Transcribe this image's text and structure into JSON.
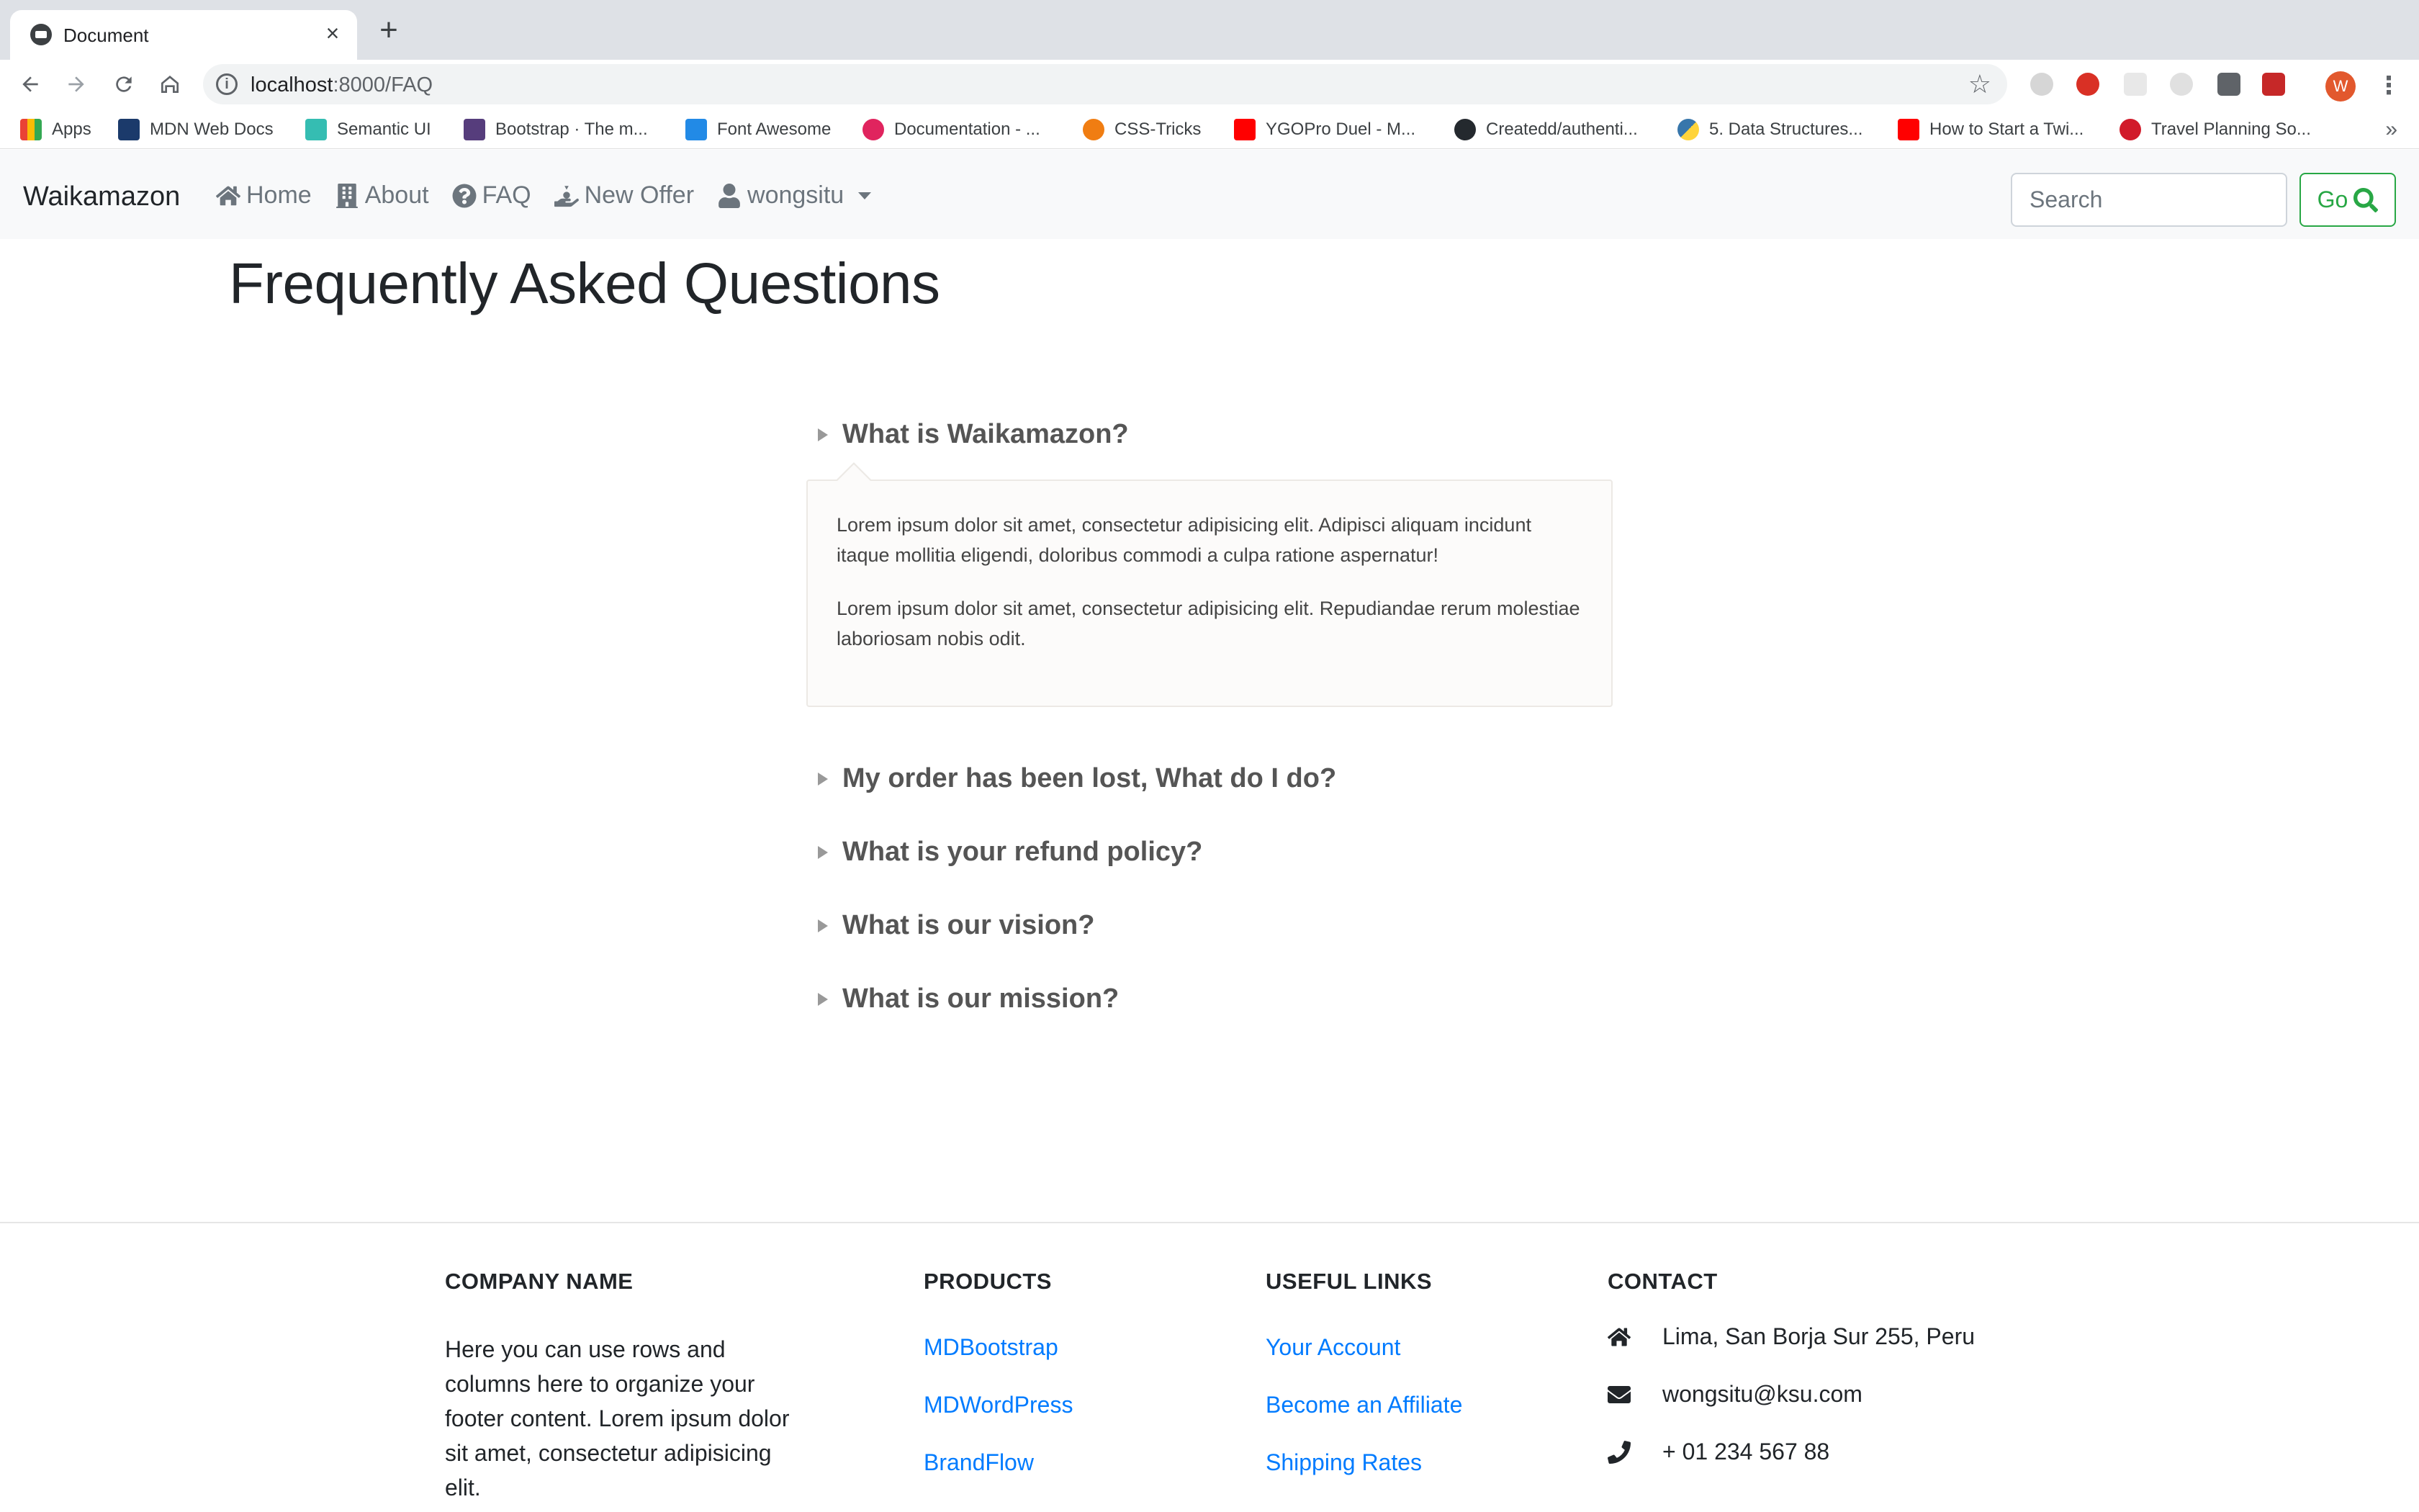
{
  "browser": {
    "tab_title": "Document",
    "url_host": "localhost",
    "url_rest": ":8000/FAQ",
    "profile_initial": "W",
    "bookmarks": [
      {
        "label": "Apps",
        "icon": "apps-grid-icon",
        "color": "#4285f4"
      },
      {
        "label": "MDN Web Docs",
        "icon": "mdn-icon",
        "color": "#1b3a6b"
      },
      {
        "label": "Semantic UI",
        "icon": "semantic-ui-icon",
        "color": "#35bdb2"
      },
      {
        "label": "Bootstrap · The m...",
        "icon": "bootstrap-icon",
        "color": "#563d7c"
      },
      {
        "label": "Font Awesome",
        "icon": "flag-icon",
        "color": "#228ae6"
      },
      {
        "label": "Documentation - ...",
        "icon": "documentation-icon",
        "color": "#e0245e"
      },
      {
        "label": "CSS-Tricks",
        "icon": "css-tricks-icon",
        "color": "#f07d12"
      },
      {
        "label": "YGOPro Duel - M...",
        "icon": "youtube-icon",
        "color": "#ff0000"
      },
      {
        "label": "Createdd/authenti...",
        "icon": "github-icon",
        "color": "#24292e"
      },
      {
        "label": "5. Data Structures...",
        "icon": "python-icon",
        "color": "#3776ab"
      },
      {
        "label": "How to Start a Twi...",
        "icon": "youtube-icon",
        "color": "#ff0000"
      },
      {
        "label": "Travel Planning So...",
        "icon": "travel-icon",
        "color": "#d11a2a"
      }
    ],
    "bookmarks_more": "»"
  },
  "navbar": {
    "brand": "Waikamazon",
    "links": [
      {
        "label": "Home",
        "icon": "home-icon"
      },
      {
        "label": "About",
        "icon": "building-icon"
      },
      {
        "label": "FAQ",
        "icon": "question-circle-icon"
      },
      {
        "label": "New Offer",
        "icon": "hand-holding-icon"
      },
      {
        "label": "wongsitu",
        "icon": "user-icon"
      }
    ],
    "search_placeholder": "Search",
    "go_label": "Go"
  },
  "faq": {
    "title": "Frequently Asked Questions",
    "questions": [
      {
        "q": "What is Waikamazon?",
        "expanded": true
      },
      {
        "q": "My order has been lost, What do I do?",
        "expanded": false
      },
      {
        "q": "What is your refund policy?",
        "expanded": false
      },
      {
        "q": "What is our vision?",
        "expanded": false
      },
      {
        "q": "What is our mission?",
        "expanded": false
      }
    ],
    "answer_paragraphs": [
      "Lorem ipsum dolor sit amet, consectetur adipisicing elit. Adipisci aliquam incidunt itaque mollitia eligendi, doloribus commodi a culpa ratione aspernatur!",
      "Lorem ipsum dolor sit amet, consectetur adipisicing elit. Repudiandae rerum molestiae laboriosam nobis odit."
    ]
  },
  "footer": {
    "company": {
      "heading": "COMPANY NAME",
      "text": "Here you can use rows and columns here to organize your footer content. Lorem ipsum dolor sit amet, consectetur adipisicing elit."
    },
    "products": {
      "heading": "PRODUCTS",
      "links": [
        "MDBootstrap",
        "MDWordPress",
        "BrandFlow"
      ]
    },
    "useful_links": {
      "heading": "USEFUL LINKS",
      "links": [
        "Your Account",
        "Become an Affiliate",
        "Shipping Rates"
      ]
    },
    "contact": {
      "heading": "CONTACT",
      "address": "Lima, San Borja Sur 255, Peru",
      "email": "wongsitu@ksu.com",
      "phone": "+ 01 234 567 88"
    }
  },
  "colors": {
    "link": "#007bff",
    "go_button": "#28a745",
    "navbar_bg": "#f8f9fa"
  }
}
